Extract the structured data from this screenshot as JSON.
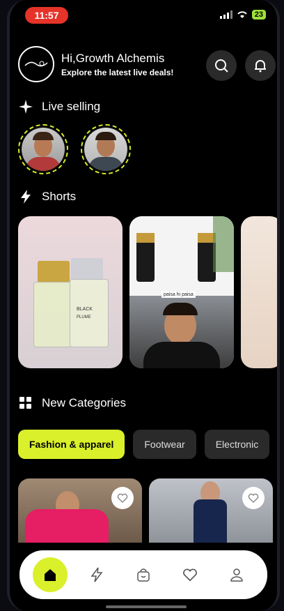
{
  "status": {
    "time": "11:57",
    "battery": "23"
  },
  "header": {
    "greeting": "Hi,Growth Alchemis",
    "subtitle": "Explore the latest live deals!",
    "logo_icon": "brand-logo-icon",
    "search_icon": "search-icon",
    "notification_icon": "bell-icon"
  },
  "sections": {
    "live": {
      "title": "Live selling",
      "icon": "sparkle-icon"
    },
    "shorts": {
      "title": "Shorts",
      "icon": "bolt-icon"
    },
    "categories": {
      "title": "New Categories",
      "icon": "grid-icon"
    }
  },
  "shorts": {
    "video_caption": "paisa hi paisa",
    "product_text": "PLUME",
    "bottle_label": "BLACK"
  },
  "categories": {
    "items": [
      {
        "label": "Fashion & apparel",
        "active": true
      },
      {
        "label": "Footwear",
        "active": false
      },
      {
        "label": "Electronic",
        "active": false
      }
    ]
  },
  "nav": {
    "items": [
      "home-icon",
      "bolt-icon",
      "bag-icon",
      "heart-icon",
      "profile-icon"
    ]
  },
  "colors": {
    "accent": "#d9f02a",
    "status_red": "#e5332a"
  }
}
